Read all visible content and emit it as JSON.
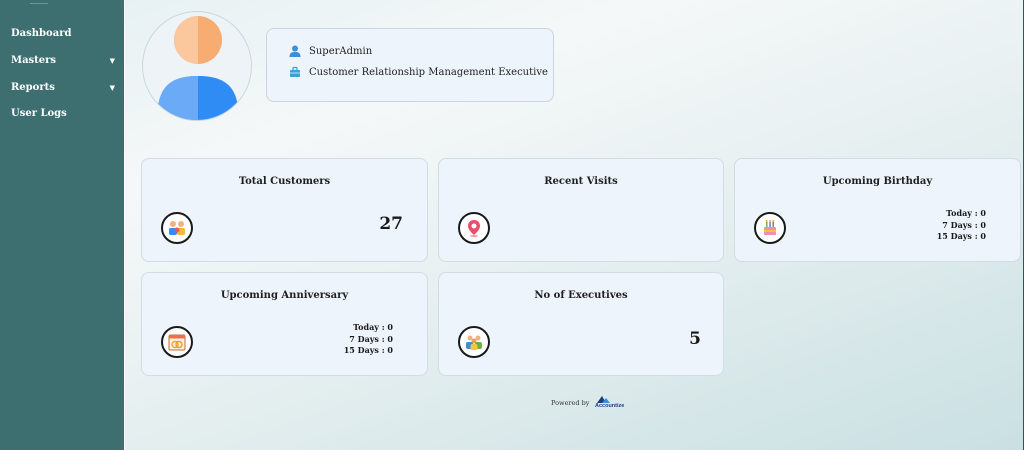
{
  "sidebar": {
    "items": [
      {
        "label": "Dashboard"
      },
      {
        "label": "Masters"
      },
      {
        "label": "Reports"
      },
      {
        "label": "User Logs"
      }
    ]
  },
  "profile": {
    "username": "SuperAdmin",
    "role": "Customer Relationship Management Executive"
  },
  "cards": {
    "total_customers": {
      "title": "Total Customers",
      "value": "27",
      "icon": "customers-icon"
    },
    "recent_visits": {
      "title": "Recent Visits",
      "icon": "location-pin-icon"
    },
    "upcoming_birthday": {
      "title": "Upcoming Birthday",
      "icon": "cake-icon",
      "lines": [
        "Today : 0",
        "7 Days : 0",
        "15 Days : 0"
      ]
    },
    "upcoming_anniversary": {
      "title": "Upcoming Anniversary",
      "icon": "rings-calendar-icon",
      "lines": [
        "Today : 0",
        "7 Days : 0",
        "15 Days : 0"
      ]
    },
    "executives": {
      "title": "No of Executives",
      "value": "5",
      "icon": "team-icon"
    }
  },
  "footer": {
    "powered_by": "Powered by",
    "brand": "Accountize"
  },
  "colors": {
    "sidebar": "#3d6f71",
    "card": "#edf4fb",
    "avatar_orange": "#f7ac72",
    "avatar_blue": "#2f8cf5"
  }
}
